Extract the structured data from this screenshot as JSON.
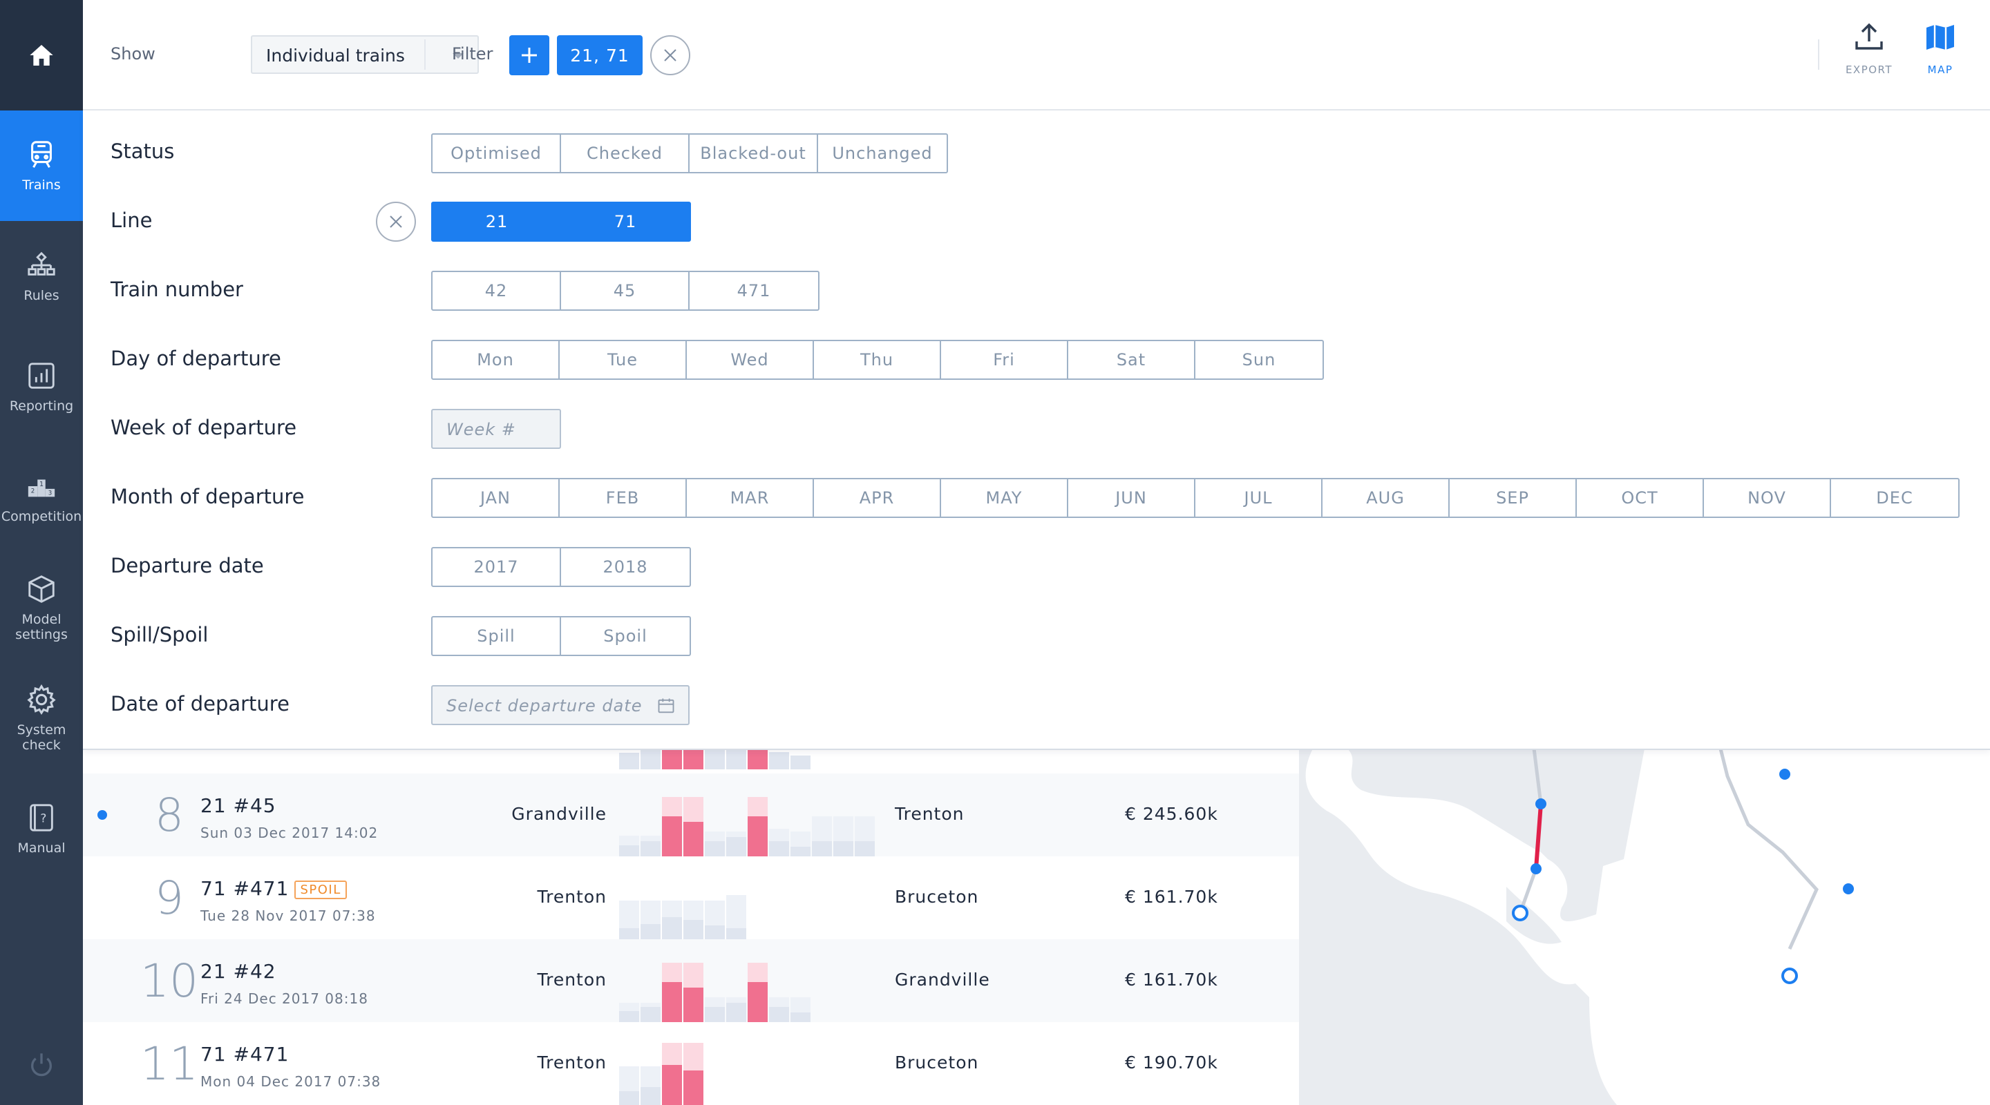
{
  "sidebar": {
    "items": [
      {
        "label": "Trains",
        "icon": "train-icon",
        "active": true
      },
      {
        "label": "Rules",
        "icon": "hierarchy-icon",
        "active": false
      },
      {
        "label": "Reporting",
        "icon": "bar-chart-icon",
        "active": false
      },
      {
        "label": "Competition",
        "icon": "podium-icon",
        "active": false
      },
      {
        "label": "Model\nsettings",
        "icon": "cube-icon",
        "active": false
      },
      {
        "label": "System\ncheck",
        "icon": "gear-icon",
        "active": false
      },
      {
        "label": "Manual",
        "icon": "manual-icon",
        "active": false
      }
    ]
  },
  "topbar": {
    "show_label": "Show",
    "show_value": "Individual trains",
    "filter_label": "Filter",
    "filter_chip": "21, 71",
    "export_label": "EXPORT",
    "map_label": "MAP"
  },
  "filters": {
    "status": {
      "label": "Status",
      "options": [
        "Optimised",
        "Checked",
        "Blacked-out",
        "Unchanged"
      ]
    },
    "line": {
      "label": "Line",
      "options": [
        "21",
        "71"
      ]
    },
    "train_number": {
      "label": "Train number",
      "options": [
        "42",
        "45",
        "471"
      ]
    },
    "day": {
      "label": "Day of departure",
      "options": [
        "Mon",
        "Tue",
        "Wed",
        "Thu",
        "Fri",
        "Sat",
        "Sun"
      ]
    },
    "week": {
      "label": "Week of departure",
      "placeholder": "Week #"
    },
    "month": {
      "label": "Month of departure",
      "options": [
        "JAN",
        "FEB",
        "MAR",
        "APR",
        "MAY",
        "JUN",
        "JUL",
        "AUG",
        "SEP",
        "OCT",
        "NOV",
        "DEC"
      ]
    },
    "year": {
      "label": "Departure date",
      "options": [
        "2017",
        "2018"
      ]
    },
    "spill": {
      "label": "Spill/Spoil",
      "options": [
        "Spill",
        "Spoil"
      ]
    },
    "date": {
      "label": "Date of departure",
      "placeholder": "Select departure date"
    }
  },
  "trains": [
    {
      "rank": "8",
      "train": "21 #45",
      "badge": "",
      "date": "Sun 03 Dec 2017 14:02",
      "origin": "Grandville",
      "destination": "Trenton",
      "revenue": "€ 245.60k",
      "selected": true
    },
    {
      "rank": "9",
      "train": "71 #471",
      "badge": "SPOIL",
      "date": "Tue 28 Nov 2017 07:38",
      "origin": "Trenton",
      "destination": "Bruceton",
      "revenue": "€ 161.70k",
      "selected": false
    },
    {
      "rank": "10",
      "train": "21 #42",
      "badge": "",
      "date": "Fri 24 Dec 2017 08:18",
      "origin": "Trenton",
      "destination": "Grandville",
      "revenue": "€ 161.70k",
      "selected": false
    },
    {
      "rank": "11",
      "train": "71 #471",
      "badge": "",
      "date": "Mon 04 Dec 2017 07:38",
      "origin": "Trenton",
      "destination": "Bruceton",
      "revenue": "€ 190.70k",
      "selected": false
    }
  ],
  "colors": {
    "accent": "#1c7ef0",
    "sidebar": "#2f3d51",
    "load_high": "#f0708f",
    "load_high_light": "#fcd9e1",
    "load_low": "#dfe5ef",
    "spoil": "#f08a2a"
  }
}
